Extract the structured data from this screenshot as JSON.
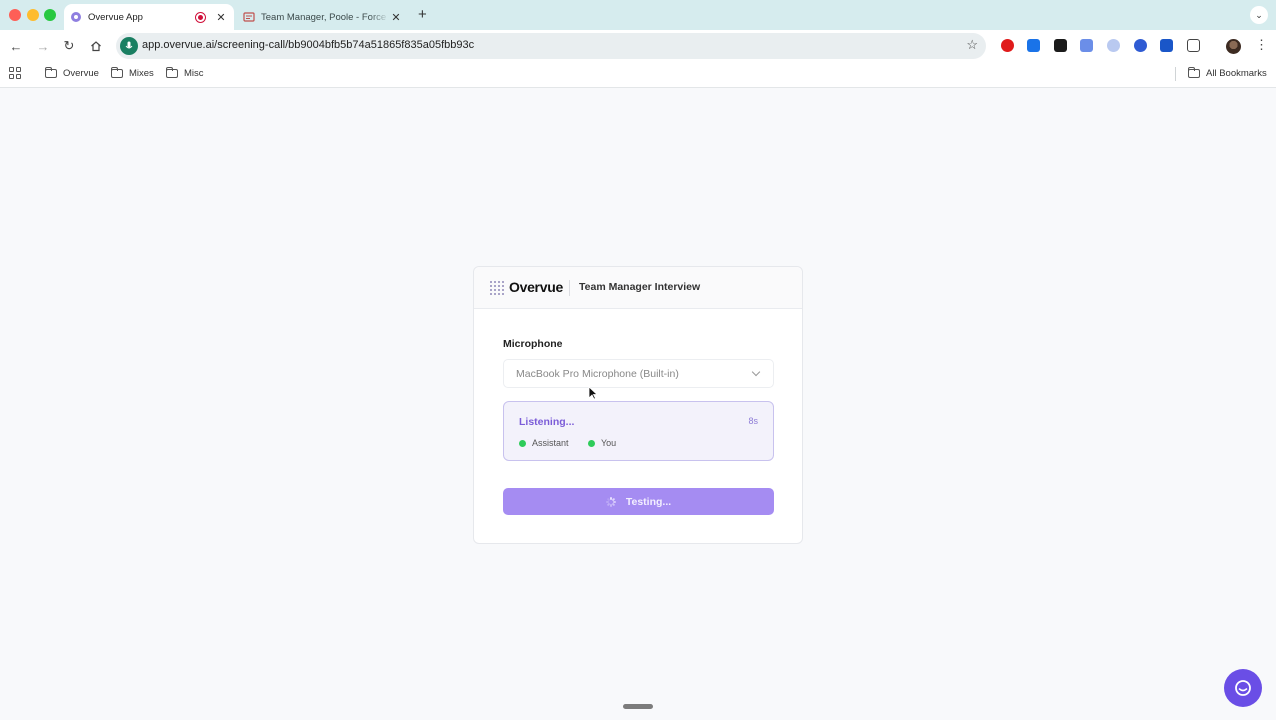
{
  "browser": {
    "tabs": [
      {
        "title": "Overvue App",
        "active": true
      },
      {
        "title": "Team Manager, Poole - Force",
        "active": false
      }
    ],
    "new_tab_symbol": "+",
    "url": "app.overvue.ai/screening-call/bb9004bfb5b74a51865f835a05fbb93c",
    "bookmarks": [
      {
        "label": "Overvue"
      },
      {
        "label": "Mixes"
      },
      {
        "label": "Misc"
      }
    ],
    "all_bookmarks_label": "All Bookmarks"
  },
  "card": {
    "brand": "Overvue",
    "interview_title": "Team Manager Interview",
    "microphone_label": "Microphone",
    "microphone_value": "MacBook Pro Microphone (Built-in)",
    "listening_text": "Listening...",
    "timer": "8s",
    "legend": [
      {
        "label": "Assistant"
      },
      {
        "label": "You"
      }
    ],
    "button_label": "Testing..."
  },
  "colors": {
    "accent": "#a58cf2",
    "listening": "#7b5cd8",
    "status_dot": "#2ecc5a",
    "chat_bubble": "#6a4ee6"
  }
}
